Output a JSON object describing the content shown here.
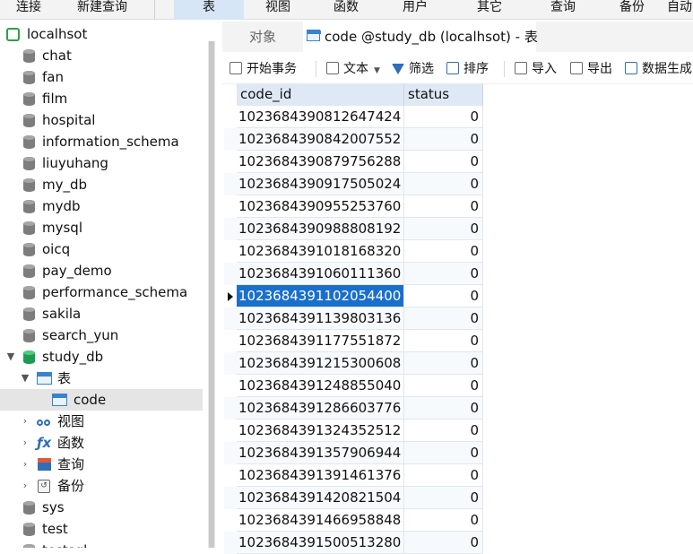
{
  "menu": {
    "items": [
      "连接",
      "新建查询",
      "表",
      "视图",
      "函数",
      "用户",
      "其它",
      "查询",
      "备份",
      "自动"
    ],
    "active": "表"
  },
  "tree": {
    "connection": "localhsot",
    "databases": [
      "chat",
      "fan",
      "film",
      "hospital",
      "information_schema",
      "liuyuhang",
      "my_db",
      "mydb",
      "mysql",
      "oicq",
      "pay_demo",
      "performance_schema",
      "sakila",
      "search_yun"
    ],
    "open_db": "study_db",
    "tables_folder": "表",
    "selected_table": "code",
    "folders": [
      "视图",
      "函数",
      "查询",
      "备份"
    ],
    "after": [
      "sys",
      "test"
    ],
    "partial": "testsql..."
  },
  "tabs": {
    "objects": "对象",
    "active": "code @study_db (localhsot) - 表"
  },
  "toolbar": {
    "begin_tx": "开始事务",
    "text": "文本",
    "filter": "筛选",
    "sort": "排序",
    "import": "导入",
    "export": "导出",
    "generate": "数据生成"
  },
  "grid": {
    "columns": [
      "code_id",
      "status"
    ],
    "rows": [
      [
        "1023684390812647424",
        "0"
      ],
      [
        "1023684390842007552",
        "0"
      ],
      [
        "1023684390879756288",
        "0"
      ],
      [
        "1023684390917505024",
        "0"
      ],
      [
        "1023684390955253760",
        "0"
      ],
      [
        "1023684390988808192",
        "0"
      ],
      [
        "1023684391018168320",
        "0"
      ],
      [
        "1023684391060111360",
        "0"
      ],
      [
        "1023684391102054400",
        "0"
      ],
      [
        "1023684391139803136",
        "0"
      ],
      [
        "1023684391177551872",
        "0"
      ],
      [
        "1023684391215300608",
        "0"
      ],
      [
        "1023684391248855040",
        "0"
      ],
      [
        "1023684391286603776",
        "0"
      ],
      [
        "1023684391324352512",
        "0"
      ],
      [
        "1023684391357906944",
        "0"
      ],
      [
        "1023684391391461376",
        "0"
      ],
      [
        "1023684391420821504",
        "0"
      ],
      [
        "1023684391466958848",
        "0"
      ],
      [
        "1023684391500513280",
        "0"
      ]
    ],
    "selected_index": 8
  },
  "colors": {
    "selection": "#1a6fcc",
    "header": "#dfe9f5",
    "db_open": "#1e9b52"
  }
}
